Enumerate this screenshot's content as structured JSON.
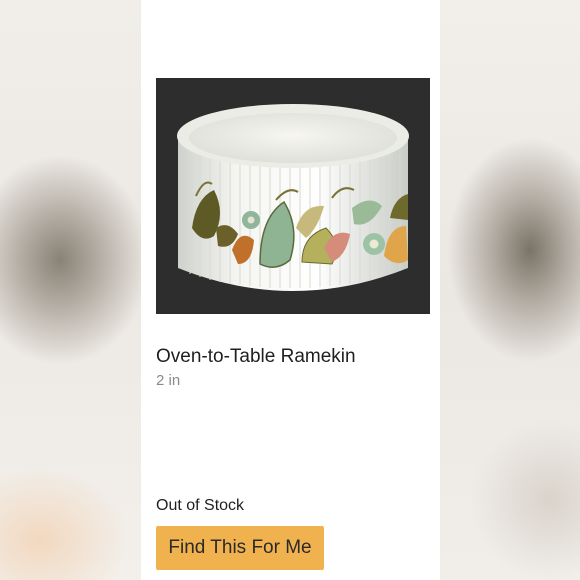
{
  "product": {
    "image_alt": "ramekin-photo",
    "title": "Oven-to-Table Ramekin",
    "size": "2 in",
    "stock_status": "Out of Stock",
    "cta_label": "Find This For Me"
  },
  "colors": {
    "cta_background": "#f0b24f",
    "photo_background": "#2b2b2b",
    "title_text": "#1f1f1f",
    "subtitle_text": "#8a8a8a"
  }
}
